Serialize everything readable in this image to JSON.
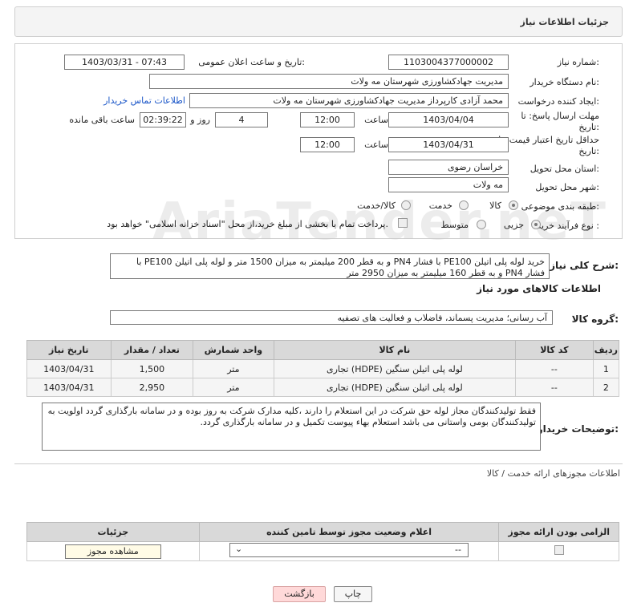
{
  "header": {
    "title": "جزئیات اطلاعات نیاز"
  },
  "form": {
    "need_number_label": "شماره نیاز:",
    "need_number": "1103004377000002",
    "announce_label": "تاریخ و ساعت اعلان عمومی:",
    "announce_value": "1403/03/31 - 07:43",
    "buyer_org_label": "نام دستگاه خریدار:",
    "buyer_org": "مدیریت جهادکشاورزی شهرستان مه ولات",
    "requester_label": "ایجاد کننده درخواست:",
    "requester": "محمد آزادی کارپرداز مدیریت جهادکشاورزی شهرستان مه ولات",
    "contact_link": "اطلاعات تماس خریدار",
    "deadline_label_1": "مهلت ارسال پاسخ: تا",
    "deadline_label_2": "تاریخ:",
    "deadline_date": "1403/04/04",
    "time_label": "ساعت",
    "deadline_time": "12:00",
    "days_value": "4",
    "days_label": "روز و",
    "remaining_time": "02:39:22",
    "remaining_label": "ساعت باقی مانده",
    "min_validity_label_1": "حداقل تاریخ اعتبار قیمت: تا",
    "min_validity_label_2": "تاریخ:",
    "validity_date": "1403/04/31",
    "validity_time": "12:00",
    "province_label": "استان محل تحویل:",
    "province": "خراسان رضوی",
    "city_label": "شهر محل تحویل:",
    "city": "مه ولات",
    "category_label": "طبقه بندی موضوعی:",
    "category_options": [
      "کالا",
      "خدمت",
      "کالا/خدمت"
    ],
    "process_label": "نوع فرآیند خرید :",
    "process_options": [
      "جزیی",
      "متوسط"
    ],
    "payment_note": "پرداخت تمام یا بخشی از مبلغ خرید،از محل \"اسناد خزانه اسلامی\" خواهد بود."
  },
  "summary": {
    "label": "شرح کلی نیاز:",
    "text": "خرید لوله پلی اتیلن PE100 با فشار PN4 و به قطر 200 میلیمتر به میزان 1500 متر و لوله پلی اتیلن PE100 با فشار PN4 و به قطر 160 میلیمتر به میزان 2950 متر"
  },
  "goods": {
    "section_title": "اطلاعات کالاهای مورد نیاز",
    "group_label": "گروه کالا:",
    "group_value": "آب رسانی؛ مدیریت پسماند، فاضلاب و فعالیت های تصفیه",
    "columns": [
      "ردیف",
      "کد کالا",
      "نام کالا",
      "واحد شمارش",
      "تعداد / مقدار",
      "تاریخ نیاز"
    ],
    "rows": [
      {
        "row": "1",
        "code": "--",
        "name": "لوله پلی اتیلن سنگین (HDPE) تجاری",
        "unit": "متر",
        "qty": "1,500",
        "date": "1403/04/31"
      },
      {
        "row": "2",
        "code": "--",
        "name": "لوله پلی اتیلن سنگین (HDPE) تجاری",
        "unit": "متر",
        "qty": "2,950",
        "date": "1403/04/31"
      }
    ]
  },
  "buyer_notes": {
    "label": "توضیحات خریدار:",
    "text": "فقط تولیدکنندگان مجاز لوله حق شرکت در این استعلام را دارند ،کلیه مدارک شرکت به روز بوده و در سامانه بارگذاری گردد اولویت به تولیدکنندگان بومی واستانی می باشد استعلام بهاء پیوست تکمیل و در سامانه بارگذاری گردد."
  },
  "permits": {
    "section_title": "اطلاعات مجوزهای ارائه خدمت / کالا",
    "columns": [
      "الزامی بودن ارائه مجوز",
      "اعلام وضعیت مجوز توسط تامین کننده",
      "جزئیات"
    ],
    "select_value": "--",
    "view_button": "مشاهده مجوز"
  },
  "footer": {
    "print_button": "چاپ",
    "back_button": "بازگشت"
  },
  "watermark": "AriaTender.neT",
  "colors": {
    "link": "#1a56c8",
    "back_button_bg": "#ffd9d9"
  }
}
